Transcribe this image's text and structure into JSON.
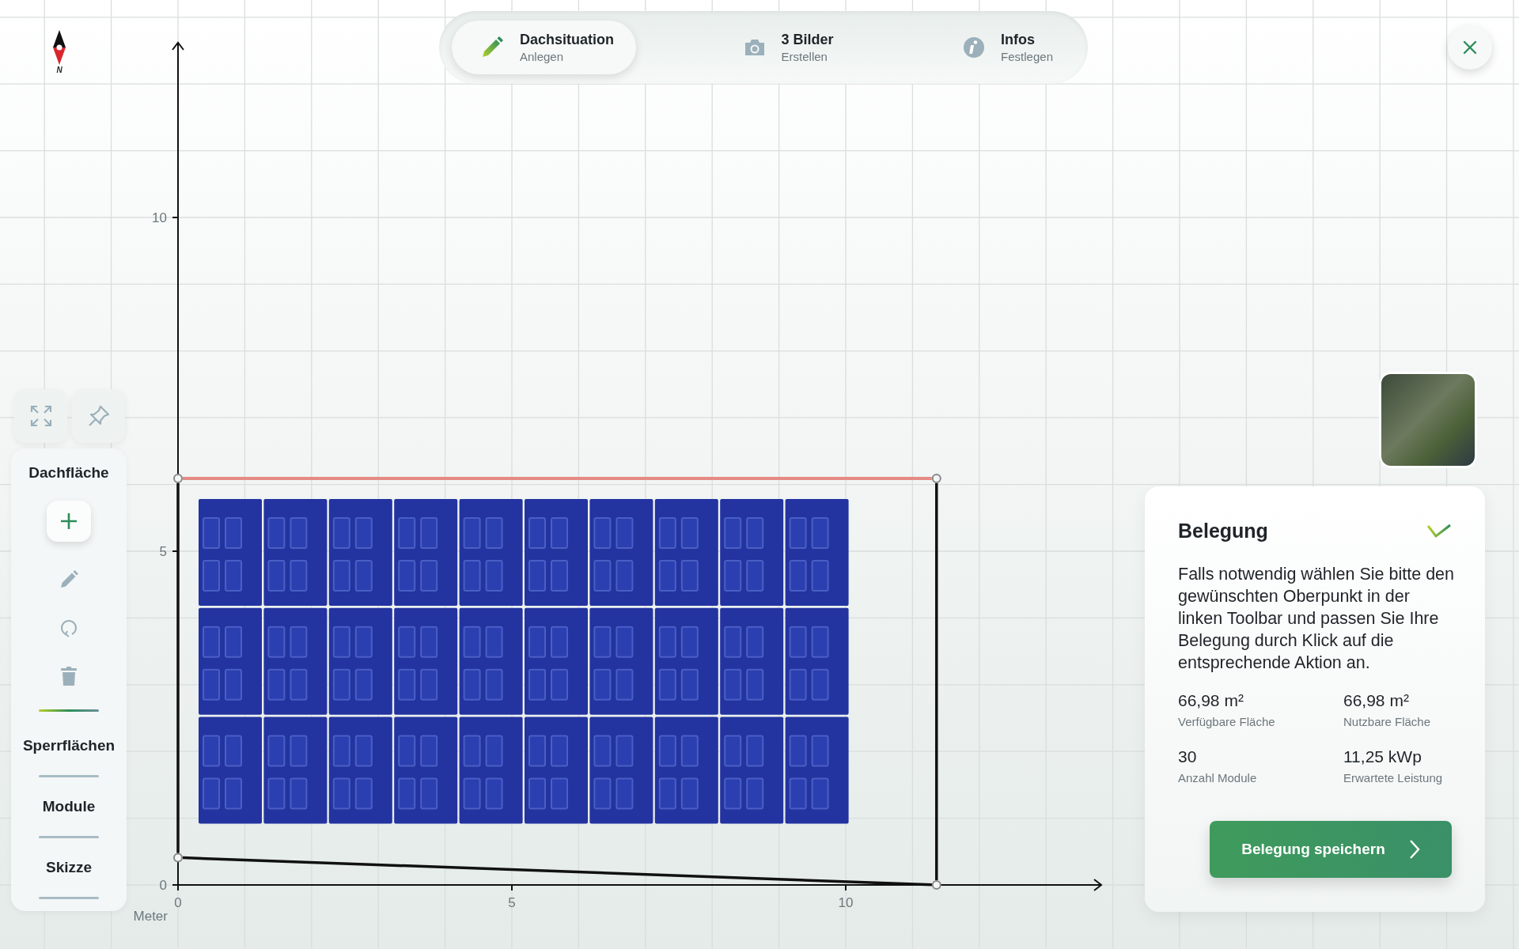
{
  "compass": {
    "label": "N"
  },
  "steps": [
    {
      "title": "Dachsituation",
      "subtitle": "Anlegen",
      "selected": true
    },
    {
      "title": "3 Bilder",
      "subtitle": "Erstellen",
      "selected": false
    },
    {
      "title": "Infos",
      "subtitle": "Festlegen",
      "selected": false
    }
  ],
  "toolbar": {
    "sections": [
      {
        "label": "Dachfläche",
        "expanded": true
      },
      {
        "label": "Sperrflächen",
        "expanded": false
      },
      {
        "label": "Module",
        "expanded": false
      },
      {
        "label": "Skizze",
        "expanded": false
      }
    ]
  },
  "axes": {
    "x_ticks": [
      "0",
      "5",
      "10"
    ],
    "y_ticks": [
      "10",
      "5",
      "0"
    ],
    "unit": "Meter"
  },
  "panel": {
    "title": "Belegung",
    "text": "Falls notwendig wählen Sie bitte den gewünschten Oberpunkt in der linken Toolbar und passen Sie Ihre Belegung durch Klick auf die entsprechende Aktion an.",
    "stats": [
      {
        "value": "66,98 m²",
        "label": "Verfügbare Fläche"
      },
      {
        "value": "66,98 m²",
        "label": "Nutzbare Fläche"
      },
      {
        "value": "30",
        "label": "Anzahl Module"
      },
      {
        "value": "11,25 kWp",
        "label": "Erwartete Leistung"
      }
    ],
    "button": "Belegung speichern"
  }
}
